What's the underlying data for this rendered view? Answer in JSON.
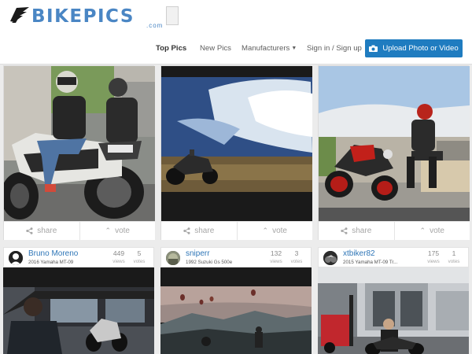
{
  "header": {
    "logo_text": "BIKEPICS",
    "logo_suffix": ".com",
    "nav": {
      "top_pics": "Top Pics",
      "new_pics": "New Pics",
      "manufacturers": "Manufacturers",
      "sign_in": "Sign in / Sign up"
    },
    "upload_label": "Upload Photo or Video",
    "colors": {
      "brand": "#4a86c4",
      "button": "#1f7cc0"
    }
  },
  "actions": {
    "share": "share",
    "vote": "vote"
  },
  "labels": {
    "views": "views",
    "votes": "votes"
  },
  "posts": [
    {
      "user": "Bruno Moreno",
      "bike": "2016 Yamaha MT-09",
      "views": "449",
      "votes": "5"
    },
    {
      "user": "sniperr",
      "bike": "1992 Suzuki Gs 500e",
      "views": "132",
      "votes": "3"
    },
    {
      "user": "xtbiker82",
      "bike": "2015 Yamaha MT-09 Tr...",
      "views": "175",
      "votes": "1"
    }
  ]
}
